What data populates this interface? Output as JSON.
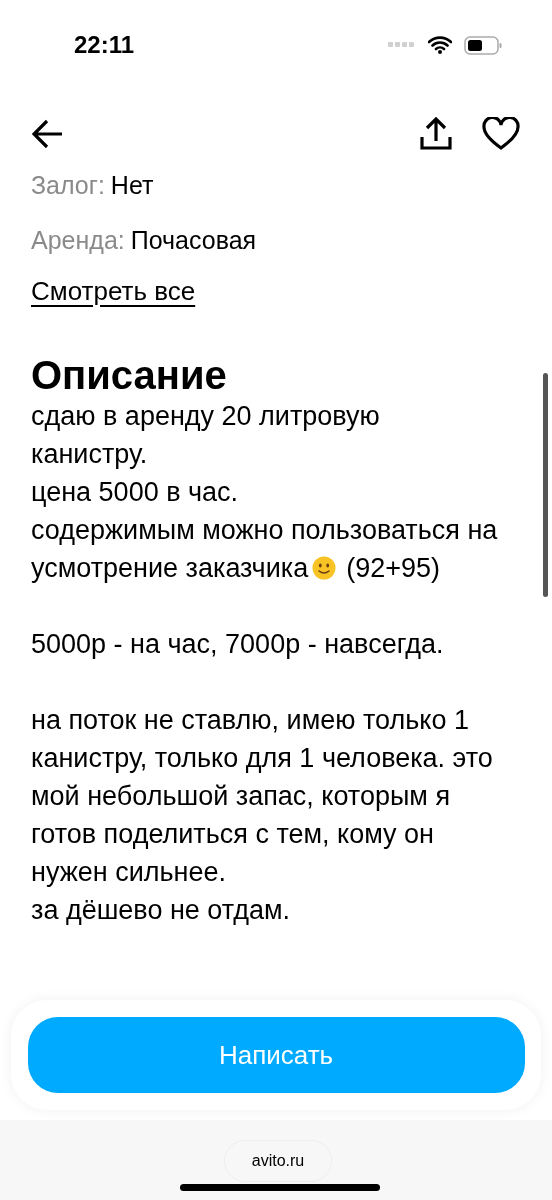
{
  "status_bar": {
    "time": "22:11"
  },
  "params": [
    {
      "label": "Залог:",
      "value": "Нет"
    },
    {
      "label": "Аренда:",
      "value": "Почасовая"
    }
  ],
  "see_all_link": "Смотреть все",
  "description": {
    "title": "Описание",
    "paragraphs": [
      {
        "lines": [
          {
            "text": "сдаю в аренду 20 литровую"
          },
          {
            "text": "канистру."
          },
          {
            "text": "цена 5000 в час."
          },
          {
            "text": "содержимым можно пользоваться на"
          },
          {
            "text": "усмотрение заказчика",
            "after_smiley": "(92+95)"
          }
        ]
      },
      {
        "lines": [
          {
            "text": "5000р - на час, 7000р - навсегда."
          }
        ]
      },
      {
        "lines": [
          {
            "text": "на поток не ставлю, имею только 1"
          },
          {
            "text": "канистру, только для 1 человека. это"
          },
          {
            "text": "мой небольшой запас, которым я"
          },
          {
            "text": "готов поделиться с тем, кому он"
          },
          {
            "text": "нужен сильнее."
          },
          {
            "text": "за дёшево не отдам."
          }
        ]
      }
    ]
  },
  "action_button": "Написать",
  "browser_address": "avito.ru"
}
